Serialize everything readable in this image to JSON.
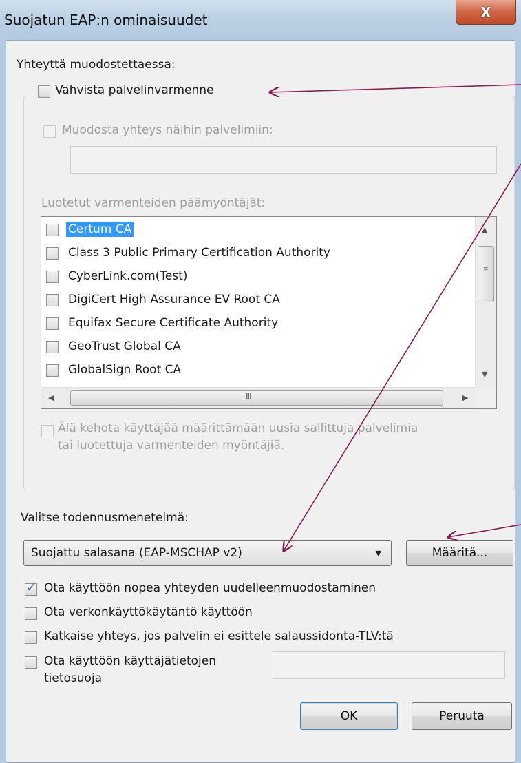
{
  "window": {
    "title": "Suojatun EAP:n ominaisuudet",
    "close_glyph": "X"
  },
  "connect_section": {
    "label": "Yhteyttä muodostettaessa:"
  },
  "verify_cert": {
    "label": "Vahvista palvelinvarmenne",
    "checked": false
  },
  "connect_servers": {
    "label": "Muodosta yhteys näihin palvelimiin:",
    "value": ""
  },
  "trusted_roots": {
    "label": "Luotetut varmenteiden päämyöntäjät:",
    "items": [
      {
        "label": "Certum CA",
        "checked": false,
        "selected": true
      },
      {
        "label": "Class 3 Public Primary Certification Authority",
        "checked": false
      },
      {
        "label": "CyberLink.com(Test)",
        "checked": false
      },
      {
        "label": "DigiCert High Assurance EV Root CA",
        "checked": false
      },
      {
        "label": "Equifax Secure Certificate Authority",
        "checked": false
      },
      {
        "label": "GeoTrust Global CA",
        "checked": false
      },
      {
        "label": "GlobalSign Root CA",
        "checked": false
      }
    ],
    "hscroll_grip": "III"
  },
  "no_prompt": {
    "line1": "Älä kehota käyttäjää määrittämään uusia sallittuja palvelimia",
    "line2": "tai luotettuja varmenteiden myöntäjiä."
  },
  "auth_method": {
    "label": "Valitse todennusmenetelmä:",
    "value": "Suojattu salasana (EAP-MSCHAP v2)"
  },
  "buttons": {
    "configure": "Määritä...",
    "ok": "OK",
    "cancel": "Peruuta"
  },
  "options": [
    {
      "label": "Ota käyttöön nopea yhteyden uudelleenmuodostaminen",
      "checked": true
    },
    {
      "label": "Ota verkonkäyttökäytäntö käyttöön",
      "checked": false
    },
    {
      "label": "Katkaise yhteys, jos palvelin ei esittele salaussidonta-TLV:tä",
      "checked": false
    },
    {
      "label": "Ota käyttöön käyttäjätietojen",
      "label2": "tietosuoja",
      "checked": false,
      "value": ""
    }
  ],
  "colors": {
    "annotation": "#8b1a4e",
    "selection": "#3399ff",
    "close_button": "#c24726"
  }
}
